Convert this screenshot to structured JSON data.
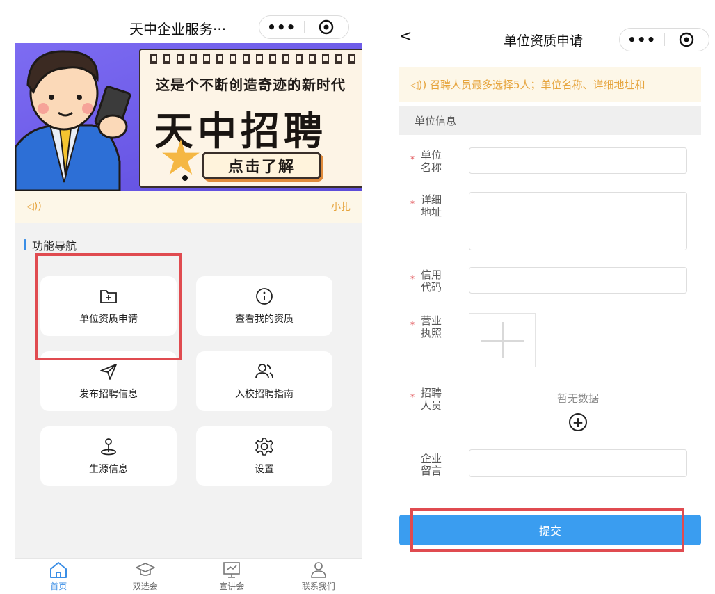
{
  "left": {
    "nav_title": "天中企业服务···",
    "capsule": {
      "more_icon": "more-dots-icon",
      "close_icon": "target-icon"
    },
    "banner": {
      "subtitle": "这是个不断创造奇迹的新时代",
      "main": "天中招聘",
      "button": "点击了解"
    },
    "notice": {
      "speaker_icon": "speaker-icon",
      "text": "小扎"
    },
    "section_title": "功能导航",
    "cards": [
      {
        "label": "单位资质申请",
        "icon": "folder-plus-icon"
      },
      {
        "label": "查看我的资质",
        "icon": "info-circle-icon"
      },
      {
        "label": "发布招聘信息",
        "icon": "send-icon"
      },
      {
        "label": "入校招聘指南",
        "icon": "users-icon"
      },
      {
        "label": "生源信息",
        "icon": "location-pin-icon"
      },
      {
        "label": "设置",
        "icon": "gear-icon"
      }
    ],
    "tabs": [
      {
        "label": "首页",
        "icon": "home-icon"
      },
      {
        "label": "双选会",
        "icon": "graduation-cap-icon"
      },
      {
        "label": "宣讲会",
        "icon": "presentation-icon"
      },
      {
        "label": "联系我们",
        "icon": "contact-icon"
      }
    ],
    "colors": {
      "accent": "#3a8ee6",
      "highlight": "#e04b50",
      "notice": "#e6a43d"
    }
  },
  "right": {
    "back": "<",
    "nav_title": "单位资质申请",
    "notice": "◁)) 召聘人员最多选择5人；单位名称、详细地址和",
    "group_title": "单位信息",
    "fields": {
      "name": {
        "l1": "单位",
        "l2": "名称",
        "required": "*",
        "value": ""
      },
      "address": {
        "l1": "详细",
        "l2": "地址",
        "required": "*",
        "value": ""
      },
      "credit": {
        "l1": "信用",
        "l2": "代码",
        "required": "*",
        "value": ""
      },
      "license": {
        "l1": "营业",
        "l2": "执照",
        "required": "*"
      },
      "staff": {
        "l1": "招聘",
        "l2": "人员",
        "required": "*",
        "empty": "暂无数据",
        "add": "+"
      },
      "message": {
        "l1": "企业",
        "l2": "留言",
        "value": ""
      }
    },
    "submit": "提交",
    "colors": {
      "submit_bg": "#3a9df0",
      "required": "#e04b50"
    }
  }
}
